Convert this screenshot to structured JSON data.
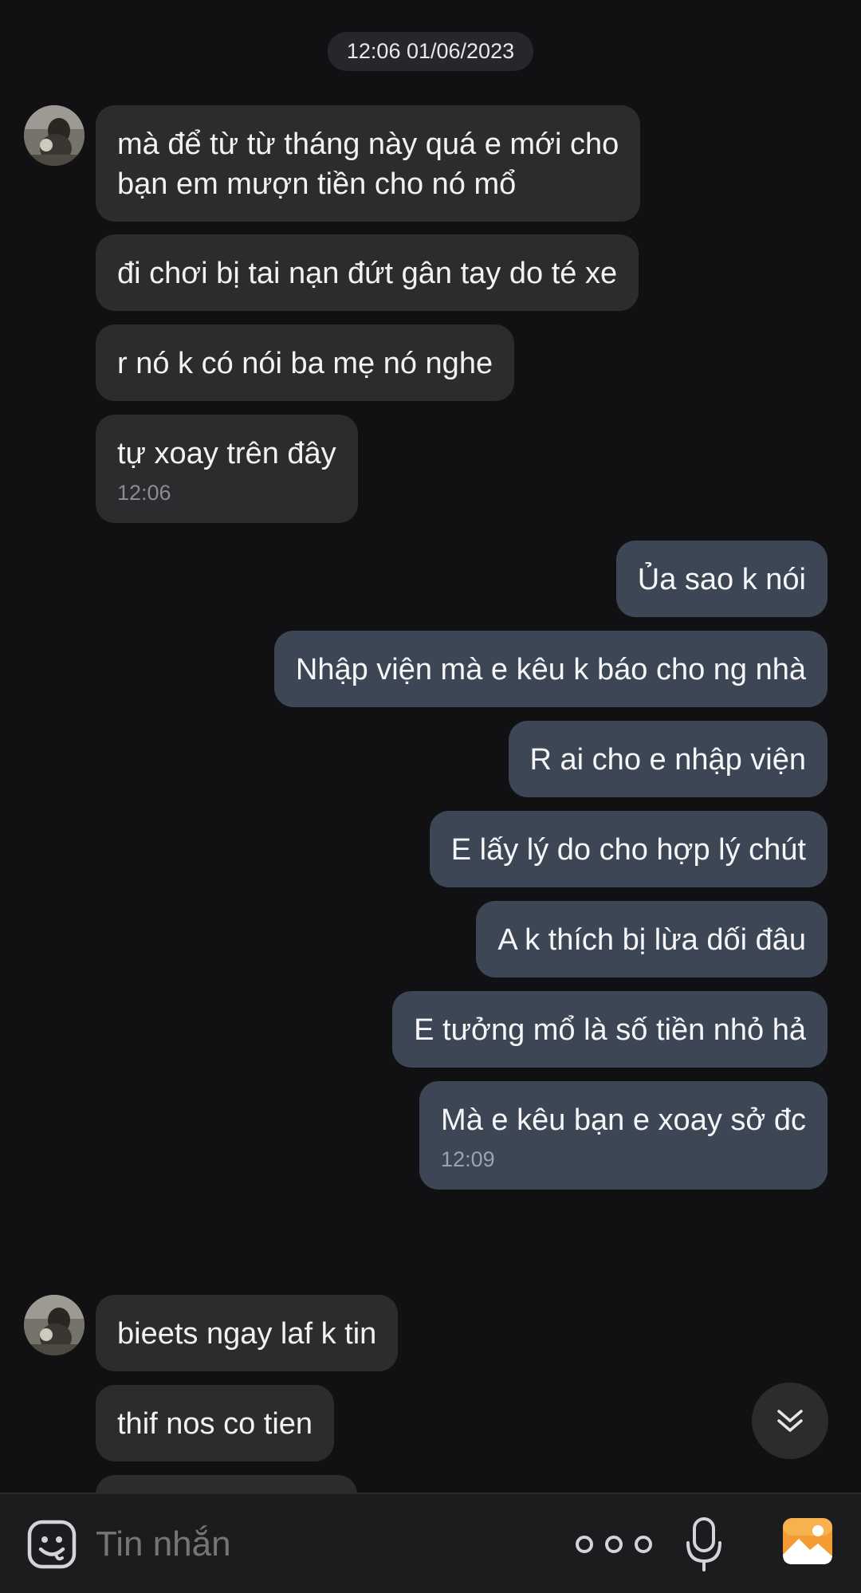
{
  "date_divider": "12:06 01/06/2023",
  "messages": [
    {
      "dir": "in",
      "text": "mà để từ từ tháng này quá e mới cho\nbạn em mượn tiền cho nó mổ"
    },
    {
      "dir": "in",
      "text": "đi chơi bị tai nạn đứt gân tay do té xe"
    },
    {
      "dir": "in",
      "text": "r nó k có nói ba mẹ nó nghe"
    },
    {
      "dir": "in",
      "text": "tự xoay trên đây",
      "time": "12:06"
    },
    {
      "dir": "out",
      "text": "Ủa sao k nói"
    },
    {
      "dir": "out",
      "text": "Nhập viện mà e kêu k báo cho ng nhà"
    },
    {
      "dir": "out",
      "text": "R ai cho e nhập viện"
    },
    {
      "dir": "out",
      "text": "E lấy lý do cho hợp lý chút"
    },
    {
      "dir": "out",
      "text": "A k thích bị lừa dối đâu"
    },
    {
      "dir": "out",
      "text": "E tưởng mổ là số tiền nhỏ hả"
    },
    {
      "dir": "out",
      "text": "Mà e kêu bạn e xoay sở đc",
      "time": "12:09"
    },
    {
      "dir": "in",
      "text": "bieets ngay laf k tin"
    },
    {
      "dir": "in",
      "text": "thif nos co tien"
    }
  ],
  "input": {
    "placeholder": "Tin nhắn"
  },
  "icons": {
    "emoji": "sticker-face-icon",
    "more": "more-dots-icon",
    "mic": "microphone-icon",
    "gallery": "gallery-image-icon",
    "scroll": "scroll-down-icon"
  },
  "colors": {
    "background": "#111113",
    "incoming_bubble": "#2c2c2e",
    "outgoing_bubble": "#3d4654",
    "gallery_accent": "#f39c33"
  }
}
